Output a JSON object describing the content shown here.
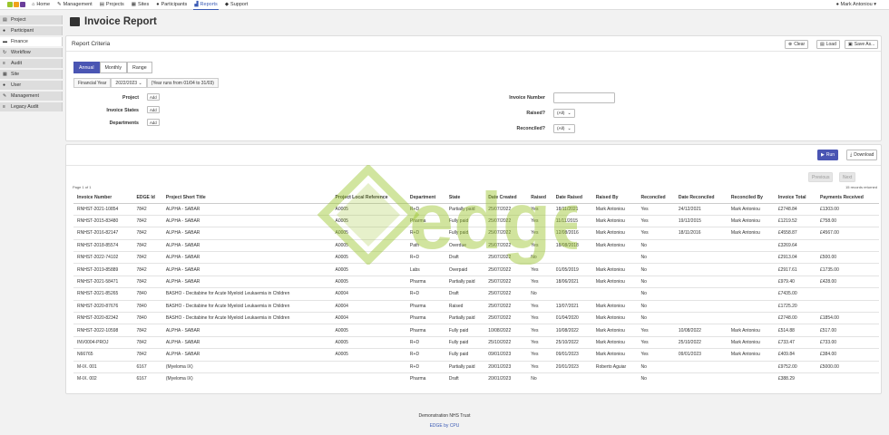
{
  "nav": {
    "items": [
      {
        "label": "Home",
        "icon": "home-icon",
        "glyph": "⌂"
      },
      {
        "label": "Management",
        "icon": "wrench-icon",
        "glyph": "✎"
      },
      {
        "label": "Projects",
        "icon": "folder-icon",
        "glyph": "▤"
      },
      {
        "label": "Sites",
        "icon": "building-icon",
        "glyph": "▦"
      },
      {
        "label": "Participants",
        "icon": "person-icon",
        "glyph": "●"
      },
      {
        "label": "Reports",
        "icon": "chart-icon",
        "glyph": "▟"
      },
      {
        "label": "Support",
        "icon": "chat-icon",
        "glyph": "◆"
      }
    ],
    "active": "Reports",
    "user": "Mark Antoniou"
  },
  "sidebar": {
    "items": [
      {
        "label": "Project",
        "icon": "folder-icon",
        "glyph": "▤"
      },
      {
        "label": "Participant",
        "icon": "person-icon",
        "glyph": "●"
      },
      {
        "label": "Finance",
        "icon": "invoice-icon",
        "glyph": "▬"
      },
      {
        "label": "Workflow",
        "icon": "workflow-icon",
        "glyph": "↻"
      },
      {
        "label": "Audit",
        "icon": "list-icon",
        "glyph": "≡"
      },
      {
        "label": "Site",
        "icon": "building-icon",
        "glyph": "▦"
      },
      {
        "label": "User",
        "icon": "user-icon",
        "glyph": "●"
      },
      {
        "label": "Management",
        "icon": "wrench-icon",
        "glyph": "✎"
      },
      {
        "label": "Legacy Audit",
        "icon": "list-icon",
        "glyph": "≡"
      }
    ],
    "active": "Finance"
  },
  "page": {
    "title": "Invoice Report"
  },
  "criteria": {
    "title": "Report Criteria",
    "clear": "Clear",
    "load": "Load",
    "save": "Save As...",
    "tabs": [
      "Annual",
      "Monthly",
      "Range"
    ],
    "fy_label": "Financial Year",
    "fy_value": "2022/2023",
    "fy_note": "(Year runs from 01/04 to 31/03)",
    "project_label": "Project",
    "states_label": "Invoice States",
    "departments_label": "Departments",
    "add": "Add",
    "invoice_number_label": "Invoice Number",
    "invoice_number_value": "",
    "raised_label": "Raised?",
    "raised_value": "(All)",
    "reconciled_label": "Reconciled?",
    "reconciled_value": "(All)"
  },
  "results": {
    "run": "Run",
    "download": "Download",
    "previous": "Previous",
    "next": "Next",
    "page_info": "Page 1 of 1",
    "results_info": "15 records returned",
    "columns": [
      "Invoice Number",
      "EDGE Id",
      "Project Short Title",
      "Project Local Reference",
      "Department",
      "State",
      "Date Created",
      "Raised",
      "Date Raised",
      "Raised By",
      "Reconciled",
      "Date Reconciled",
      "Reconciled By",
      "Invoice Total",
      "Payments Received"
    ],
    "rows": [
      [
        "RNHST-2021-10854",
        "7842",
        "ALPHA - SABAR",
        "A0005",
        "R+D",
        "Partially paid",
        "25/07/2022",
        "Yes",
        "18/11/2021",
        "Mark Antoniou",
        "Yes",
        "24/12/2021",
        "Mark Antoniou",
        "£2748.84",
        "£1303.00"
      ],
      [
        "RNHST-2015-83480",
        "7842",
        "ALPHA - SABAR",
        "A0005",
        "Pharma",
        "Fully paid",
        "25/07/2022",
        "Yes",
        "11/11/2015",
        "Mark Antoniou",
        "Yes",
        "19/12/2015",
        "Mark Antoniou",
        "£1219.52",
        "£758.00"
      ],
      [
        "RNHST-2016-82147",
        "7842",
        "ALPHA - SABAR",
        "A0005",
        "R+D",
        "Fully paid",
        "25/07/2022",
        "Yes",
        "12/08/2016",
        "Mark Antoniou",
        "Yes",
        "18/11/2016",
        "Mark Antoniou",
        "£4558.87",
        "£4567.00"
      ],
      [
        "RNHST-2018-85574",
        "7842",
        "ALPHA - SABAR",
        "A0005",
        "Path",
        "Overdue",
        "25/07/2022",
        "Yes",
        "18/08/2018",
        "Mark Antoniou",
        "No",
        "",
        "",
        "£3269.64",
        ""
      ],
      [
        "RNHST-2022-74102",
        "7842",
        "ALPHA - SABAR",
        "A0005",
        "R+D",
        "Draft",
        "25/07/2022",
        "No",
        "",
        "",
        "No",
        "",
        "",
        "£2913.04",
        "£500.00"
      ],
      [
        "RNHST-2019-85889",
        "7842",
        "ALPHA - SABAR",
        "A0005",
        "Labs",
        "Overpaid",
        "25/07/2022",
        "Yes",
        "01/05/2019",
        "Mark Antoniou",
        "No",
        "",
        "",
        "£2917.61",
        "£1735.00"
      ],
      [
        "RNHST-2021-58471",
        "7842",
        "ALPHA - SABAR",
        "A0005",
        "Pharma",
        "Partially paid",
        "25/07/2022",
        "Yes",
        "18/06/2021",
        "Mark Antoniou",
        "No",
        "",
        "",
        "£979.40",
        "£428.00"
      ],
      [
        "RNHST-2021-85265",
        "7840",
        "BASHO - Decitabine for Acute Myeloid Leukaemia in Children",
        "A0004",
        "R+D",
        "Draft",
        "25/07/2022",
        "No",
        "",
        "",
        "No",
        "",
        "",
        "£7435.00",
        ""
      ],
      [
        "RNHST-2020-87676",
        "7840",
        "BASHO - Decitabine for Acute Myeloid Leukaemia in Children",
        "A0004",
        "Pharma",
        "Raised",
        "25/07/2022",
        "Yes",
        "13/07/2021",
        "Mark Antoniou",
        "No",
        "",
        "",
        "£1725.20",
        ""
      ],
      [
        "RNHST-2020-82342",
        "7840",
        "BASHO - Decitabine for Acute Myeloid Leukaemia in Children",
        "A0004",
        "Pharma",
        "Partially paid",
        "25/07/2022",
        "Yes",
        "01/04/2020",
        "Mark Antoniou",
        "No",
        "",
        "",
        "£2748.00",
        "£1854.00"
      ],
      [
        "RNHST-2022-10598",
        "7842",
        "ALPHA - SABAR",
        "A0005",
        "Pharma",
        "Fully paid",
        "10/08/2022",
        "Yes",
        "10/08/2022",
        "Mark Antoniou",
        "Yes",
        "10/08/2022",
        "Mark Antoniou",
        "£514.88",
        "£517.00"
      ],
      [
        "INV0004-PROJ",
        "7842",
        "ALPHA - SABAR",
        "A0005",
        "R+D",
        "Fully paid",
        "25/10/2022",
        "Yes",
        "25/10/2022",
        "Mark Antoniou",
        "Yes",
        "25/10/2022",
        "Mark Antoniou",
        "£733.47",
        "£733.00"
      ],
      [
        "N66765",
        "7842",
        "ALPHA - SABAR",
        "A0005",
        "R+D",
        "Fully paid",
        "09/01/2023",
        "Yes",
        "09/01/2023",
        "Mark Antoniou",
        "Yes",
        "09/01/2023",
        "Mark Antoniou",
        "£409.84",
        "£384.00"
      ],
      [
        "M-IX. 001",
        "6167",
        "(Myeloma IX)",
        "",
        "R+D",
        "Partially paid",
        "20/01/2023",
        "Yes",
        "20/01/2023",
        "Roberto Aguiar",
        "No",
        "",
        "",
        "£9752.00",
        "£5000.00"
      ],
      [
        "M-IX. 002",
        "6167",
        "(Myeloma IX)",
        "",
        "Pharma",
        "Draft",
        "20/01/2023",
        "No",
        "",
        "",
        "No",
        "",
        "",
        "£388.29",
        ""
      ]
    ]
  },
  "footer": {
    "org": "Demonstration NHS Trust",
    "brand": "EDGE by CPU"
  },
  "watermark": {
    "text": "edge"
  },
  "colors": {
    "accent": "#4a55b3",
    "watermark": "#9ac52b"
  }
}
